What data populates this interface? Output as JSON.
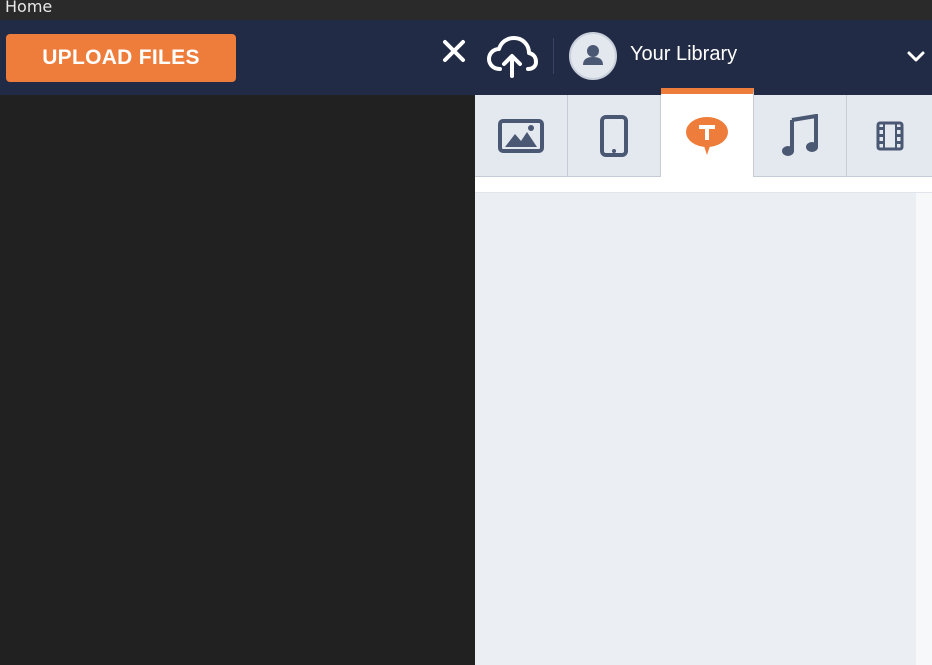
{
  "topbar": {
    "home_label": "Home"
  },
  "header": {
    "upload_label": "UPLOAD FILES",
    "library_title": "Your Library",
    "icons": {
      "close": "close-icon",
      "cloud": "cloud-upload-icon",
      "avatar": "user-avatar-icon",
      "chevron": "chevron-down-icon"
    }
  },
  "tabs": [
    {
      "name": "images",
      "icon": "image-icon",
      "active": false
    },
    {
      "name": "mobile",
      "icon": "phone-icon",
      "active": false
    },
    {
      "name": "text",
      "icon": "text-bubble-icon",
      "active": true
    },
    {
      "name": "audio",
      "icon": "music-note-icon",
      "active": false
    },
    {
      "name": "video",
      "icon": "film-icon",
      "active": false
    }
  ],
  "colors": {
    "accent": "#ee7d3c",
    "header": "#222b45",
    "icon": "#4a5873"
  }
}
